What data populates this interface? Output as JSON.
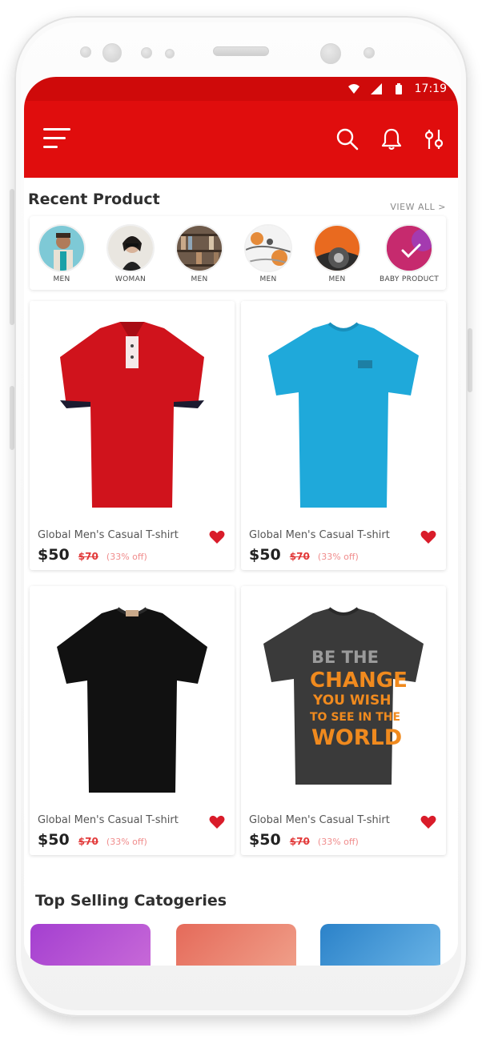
{
  "status": {
    "time": "17:19"
  },
  "app": {
    "icons": [
      "menu-icon",
      "search-icon",
      "bell-icon",
      "filter-icon"
    ],
    "accent": "#e00d0d"
  },
  "recent": {
    "title": "Recent Product",
    "view_all": "VIEW ALL >",
    "categories": [
      {
        "label": "MEN"
      },
      {
        "label": "WOMAN"
      },
      {
        "label": "MEN"
      },
      {
        "label": "MEN"
      },
      {
        "label": "MEN"
      },
      {
        "label": "BABY PRODUCT"
      }
    ]
  },
  "products": [
    {
      "title": "Global Men's Casual T-shirt",
      "price": "$50",
      "old_price": "$70",
      "discount": "(33% off)",
      "color": "#d0131c"
    },
    {
      "title": "Global Men's Casual T-shirt",
      "price": "$50",
      "old_price": "$70",
      "discount": "(33% off)",
      "color": "#1fa9da"
    },
    {
      "title": "Global Men's Casual T-shirt",
      "price": "$50",
      "old_price": "$70",
      "discount": "(33% off)",
      "color": "#111111"
    },
    {
      "title": "Global Men's Casual T-shirt",
      "price": "$50",
      "old_price": "$70",
      "discount": "(33% off)",
      "color": "#3a3a3a"
    }
  ],
  "print": {
    "line1": "BE THE",
    "line2": "CHANGE",
    "line3": "YOU WISH",
    "line4": "TO SEE IN THE",
    "line5": "WORLD"
  },
  "top_selling": {
    "title": "Top Selling Catogeries"
  }
}
